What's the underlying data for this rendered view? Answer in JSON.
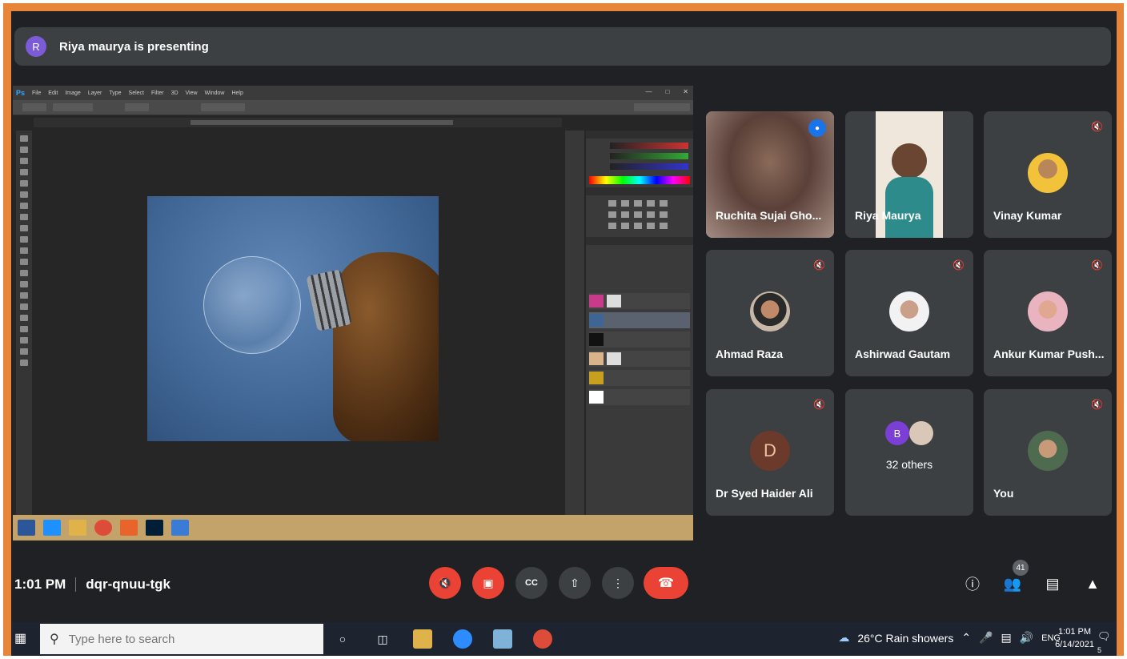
{
  "banner": {
    "avatar_letter": "R",
    "text": "Riya maurya is presenting"
  },
  "photoshop": {
    "logo": "Ps",
    "menu": [
      "File",
      "Edit",
      "Image",
      "Layer",
      "Type",
      "Select",
      "Filter",
      "3D",
      "View",
      "Window",
      "Help"
    ]
  },
  "participants": [
    {
      "name": "Ruchita Sujai Gho...",
      "muted": false,
      "speaking": true
    },
    {
      "name": "Riya Maurya",
      "muted": false,
      "speaking": false
    },
    {
      "name": "Vinay Kumar",
      "muted": true
    },
    {
      "name": "Ahmad Raza",
      "muted": true
    },
    {
      "name": "Ashirwad Gautam",
      "muted": true
    },
    {
      "name": "Ankur Kumar Push...",
      "muted": true
    },
    {
      "name": "Dr Syed Haider Ali",
      "muted": true,
      "initial": "D"
    },
    {
      "others_letter": "B",
      "others_text": "32 others"
    },
    {
      "name": "You",
      "muted": true
    }
  ],
  "meeting": {
    "time": "1:01 PM",
    "code": "dqr-qnuu-tgk",
    "participant_count": "41"
  },
  "colors": {
    "meet_bg": "#202124",
    "tile_bg": "#3c4043",
    "red": "#ea4335",
    "accent": "#8ab4f8",
    "frame": "#e7863a"
  },
  "taskbar": {
    "search_placeholder": "Type here to search",
    "weather": "26°C  Rain showers",
    "lang": "ENG",
    "time": "1:01 PM",
    "date": "6/14/2021",
    "notif_count": "5"
  }
}
